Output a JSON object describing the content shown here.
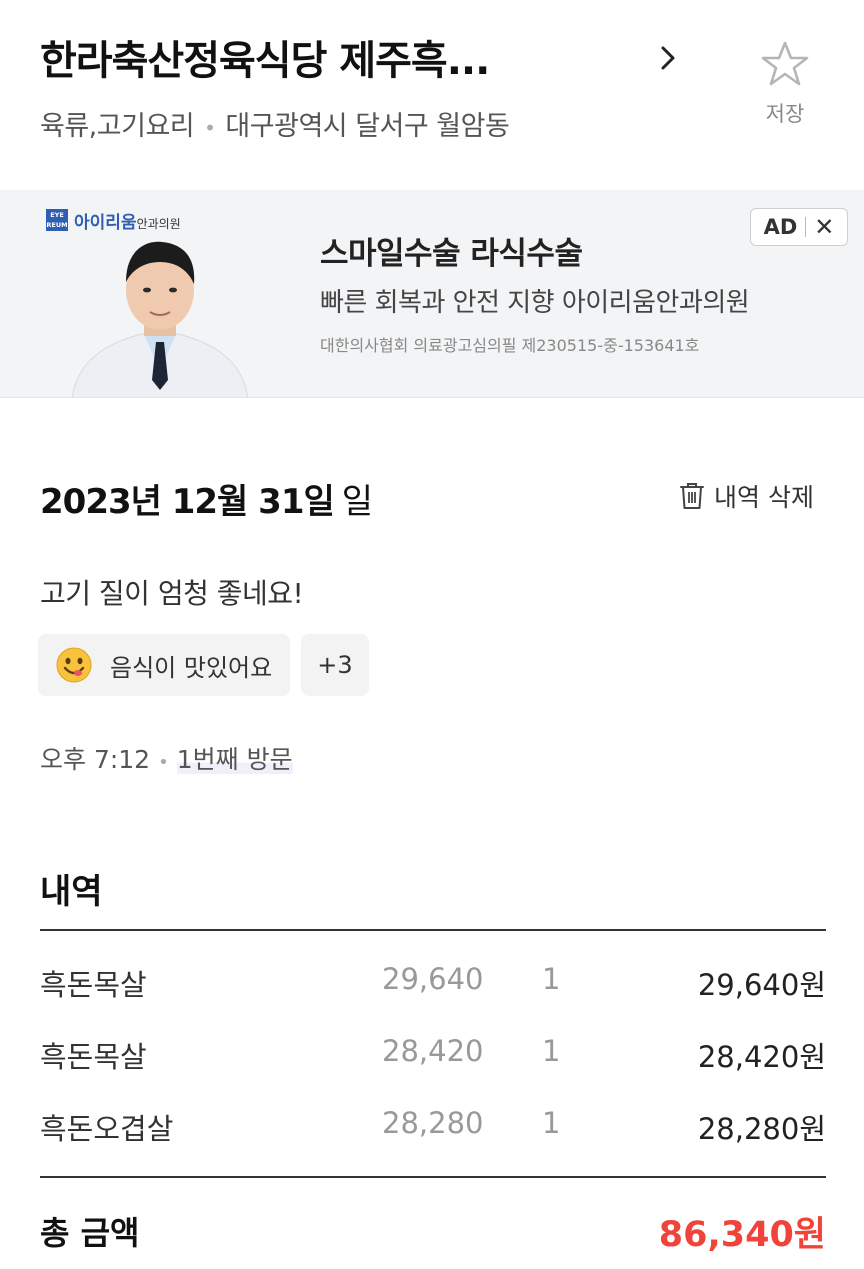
{
  "header": {
    "title": "한라축산정육식당 제주흑...",
    "category": "육류,고기요리",
    "address": "대구광역시 달서구 월암동",
    "save_label": "저장",
    "icons": {
      "detail": "chevron-right-icon",
      "save": "star-outline-icon"
    }
  },
  "ad": {
    "logo_mark": "EYE REUM",
    "logo_name": "아이리움",
    "logo_sub": "안과의원",
    "headline": "스마일수술 라식수술",
    "subline": "빠른 회복과 안전 지향 아이리움안과의원",
    "notice": "대한의사협회 의료광고심의필 제230515-중-153641호",
    "badge": "AD",
    "close": "✕",
    "colors": {
      "brand": "#2f5fb4",
      "background": "#f3f4f6"
    }
  },
  "visit": {
    "date": "2023년 12월 31일",
    "weekday": "일",
    "delete_label": "내역 삭제",
    "review_text": "고기 질이 엄청 좋네요!",
    "tags": [
      {
        "emoji": "smiling-face-icon",
        "label": "음식이 맛있어요"
      }
    ],
    "more_tags": "+3",
    "time": "오후 7:12",
    "visit_count": "1번째 방문"
  },
  "receipt": {
    "title": "내역",
    "items": [
      {
        "name": "흑돈목살",
        "unit_price": "29,640",
        "qty": "1",
        "amount": "29,640원"
      },
      {
        "name": "흑돈목살",
        "unit_price": "28,420",
        "qty": "1",
        "amount": "28,420원"
      },
      {
        "name": "흑돈오겹살",
        "unit_price": "28,280",
        "qty": "1",
        "amount": "28,280원"
      }
    ],
    "total_label": "총 금액",
    "total_amount": "86,340원",
    "colors": {
      "total": "#f0433a"
    }
  }
}
